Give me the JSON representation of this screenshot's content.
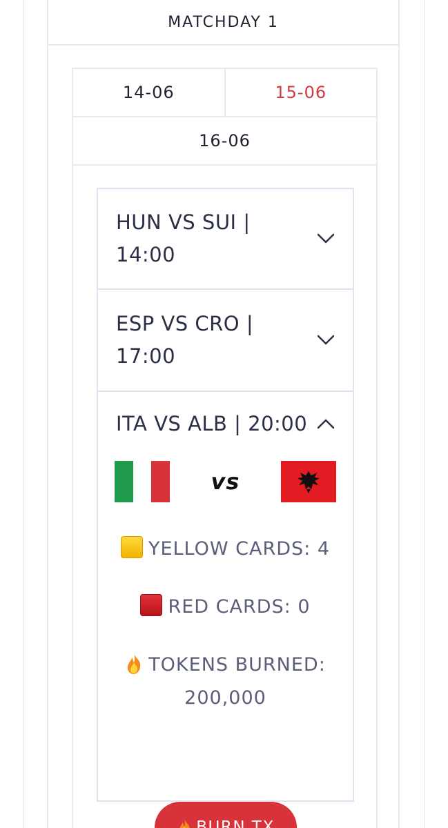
{
  "matchday": {
    "title": "MATCHDAY 1"
  },
  "dates": {
    "tabs": [
      {
        "label": "14-06",
        "active": false
      },
      {
        "label": "15-06",
        "active": true
      },
      {
        "label": "16-06",
        "active": false
      }
    ]
  },
  "matches": [
    {
      "title_line1": "HUN VS SUI |",
      "title_line2": "14:00",
      "expanded": false
    },
    {
      "title_line1": "ESP VS CRO |",
      "title_line2": "17:00",
      "expanded": false
    },
    {
      "title": "ITA VS ALB | 20:00",
      "expanded": true,
      "home_flag": "italy-flag",
      "away_flag": "albania-flag",
      "vs_label": "vs",
      "yellow_cards": "YELLOW CARDS: 4",
      "red_cards": "RED CARDS: 0",
      "tokens_burned_label": "TOKENS BURNED:",
      "tokens_burned_value": "200,000",
      "burn_button": "BURN TX"
    }
  ],
  "colors": {
    "accent_red": "#d8323a",
    "active_date": "#d33a40",
    "border": "#e8eaf0"
  }
}
